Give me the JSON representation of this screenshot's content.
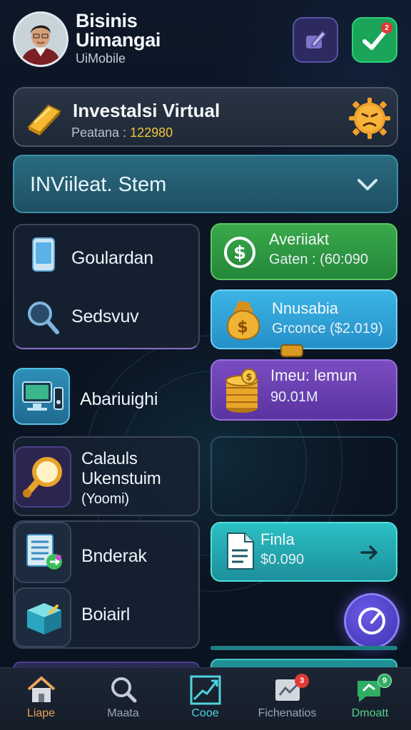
{
  "header": {
    "title_line1": "Bisinis",
    "title_line2": "Uimangai",
    "subtitle": "UiMobile",
    "check_badge": "2"
  },
  "invest_card": {
    "title": "Investalsi Virtual",
    "subtitle_label": "Peatana :",
    "subtitle_value": "122980"
  },
  "selector": {
    "value": "INViileat. Stem"
  },
  "left_list": [
    {
      "label": "Goulardan",
      "icon": "tablet-icon"
    },
    {
      "label": "Sedsvuv",
      "icon": "magnifier-icon"
    },
    {
      "label": "Abariuighi",
      "icon": "computer-icon"
    }
  ],
  "calc_item": {
    "line1": "Calauls",
    "line2": "Ukenstuim",
    "line3": "(Yoomi)"
  },
  "bottom_list": [
    {
      "label": "Bnderak",
      "icon": "ledger-icon"
    },
    {
      "label": "Boiairl",
      "icon": "box-icon"
    }
  ],
  "right_cards": {
    "green": {
      "title": "Averiiakt",
      "subtitle": "Gaten : (60:090"
    },
    "blue": {
      "title": "Nnusabia",
      "subtitle": "Grconce ($2.019)"
    },
    "purple": {
      "title": "Imeu: lemun",
      "subtitle": "90.01M"
    },
    "teal": {
      "title": "Finla",
      "subtitle": "$0.090"
    }
  },
  "nav": [
    {
      "label": "Liape",
      "icon": "home-icon",
      "color": "#e8a35a"
    },
    {
      "label": "Maata",
      "icon": "search-icon",
      "color": "#9aa6b4"
    },
    {
      "label": "Cooe",
      "icon": "chart-icon",
      "color": "#4fd4e0"
    },
    {
      "label": "Fichenatios",
      "icon": "notification-icon",
      "color": "#9aa6b4",
      "badge": "3"
    },
    {
      "label": "Dmoatt",
      "icon": "chat-icon",
      "color": "#5bd18a",
      "badge": "9"
    }
  ],
  "colors": {
    "accent_teal": "#2fb8c0",
    "gold": "#f3c43a",
    "green": "#3aa94a",
    "blue": "#3cb4e4",
    "purple": "#7a4cc0"
  }
}
